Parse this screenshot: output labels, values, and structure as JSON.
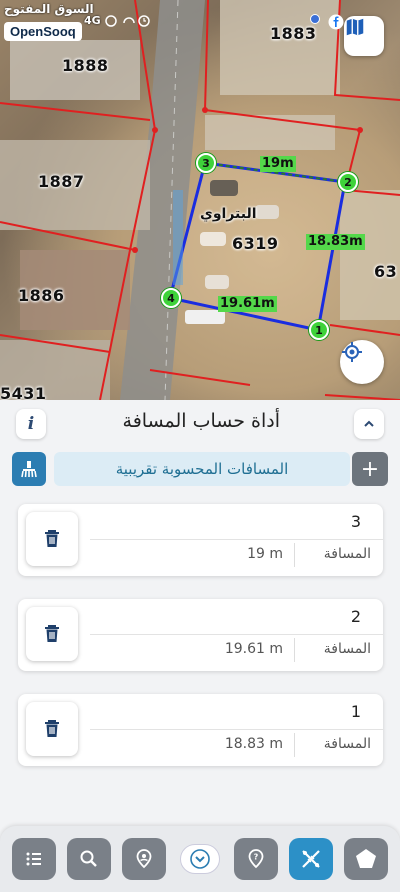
{
  "status": {
    "brand_ar": "السوق المفتوح",
    "brand_en": "OpenSooq",
    "network": "4G",
    "icons": [
      "whatsapp-icon",
      "headset-icon",
      "clock-icon",
      "facebook-icon"
    ]
  },
  "map": {
    "parcels": [
      "1888",
      "1887",
      "1886",
      "5431",
      "1883",
      "6319",
      "63"
    ],
    "place_label": "البتراوي",
    "segments": [
      {
        "label": "19m"
      },
      {
        "label": "18.83m"
      },
      {
        "label": "19.61m"
      }
    ],
    "vertices": [
      "1",
      "2",
      "3",
      "4"
    ]
  },
  "sheet": {
    "title": "أداة حساب المسافة",
    "info_label": "i",
    "approx_note": "المسافات المحسوبة تقريبية",
    "add_label": "+",
    "measurements": [
      {
        "number": "3",
        "label": "المسافة",
        "value": "19 m"
      },
      {
        "number": "2",
        "label": "المسافة",
        "value": "19.61 m"
      },
      {
        "number": "1",
        "label": "المسافة",
        "value": "18.83 m"
      }
    ]
  },
  "nav": {
    "items": [
      "list-icon",
      "search-icon",
      "location-pin-icon",
      "chevron-down-icon",
      "help-pin-icon",
      "ruler-tool-icon",
      "shape-icon"
    ],
    "active": "ruler-tool-icon"
  },
  "colors": {
    "accent": "#2c7db2",
    "nav_active": "#2c90c7",
    "measure_green": "#54d84a",
    "parcel_border": "#e02020",
    "line_blue": "#1a2de0"
  }
}
